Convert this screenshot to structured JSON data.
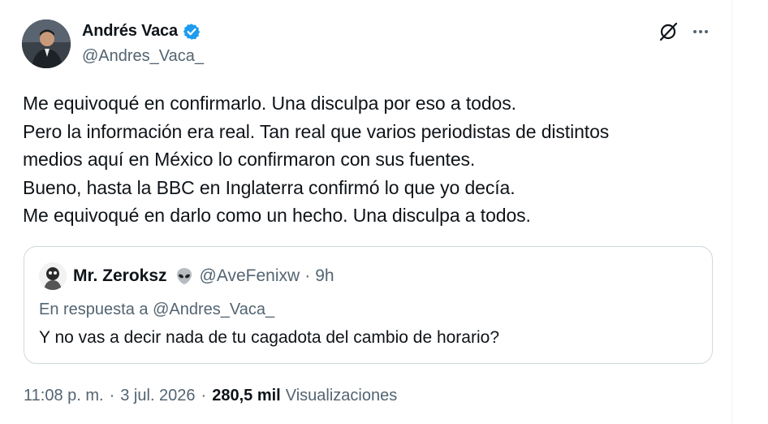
{
  "author": {
    "display_name": "Andrés Vaca",
    "handle": "@Andres_Vaca_",
    "verified": true,
    "verified_color": "#1d9bf0",
    "avatar_icon": "profile-photo"
  },
  "actions": {
    "grok_icon": "grok-icon",
    "more_icon": "more-horizontal-icon"
  },
  "tweet": {
    "lines": [
      "Me equivoqué en confirmarlo. Una disculpa por eso a todos.",
      "Pero la información era real. Tan real que varios periodistas de distintos",
      "medios aquí en México lo confirmaron con sus fuentes.",
      "Bueno, hasta la BBC en Inglaterra confirmó lo que yo decía.",
      "Me equivoqué en darlo como un hecho. Una disculpa a todos."
    ]
  },
  "quote": {
    "display_name": "Mr. Zeroksz",
    "emoji_icon": "alien-emoji-icon",
    "handle": "@AveFenixw",
    "dot": "·",
    "time": "9h",
    "reply_prefix": "En respuesta a",
    "reply_to": "@Andres_Vaca_",
    "text": "Y no vas a decir nada de tu cagadota del cambio de horario?"
  },
  "meta": {
    "time": "11:08 p. m.",
    "sep": "·",
    "date": "3 jul. 2026",
    "views_count": "280,5 mil",
    "views_label": "Visualizaciones"
  },
  "colors": {
    "text_primary": "#0f1419",
    "text_secondary": "#536471",
    "border": "#cfd9de",
    "accent": "#1d9bf0"
  }
}
